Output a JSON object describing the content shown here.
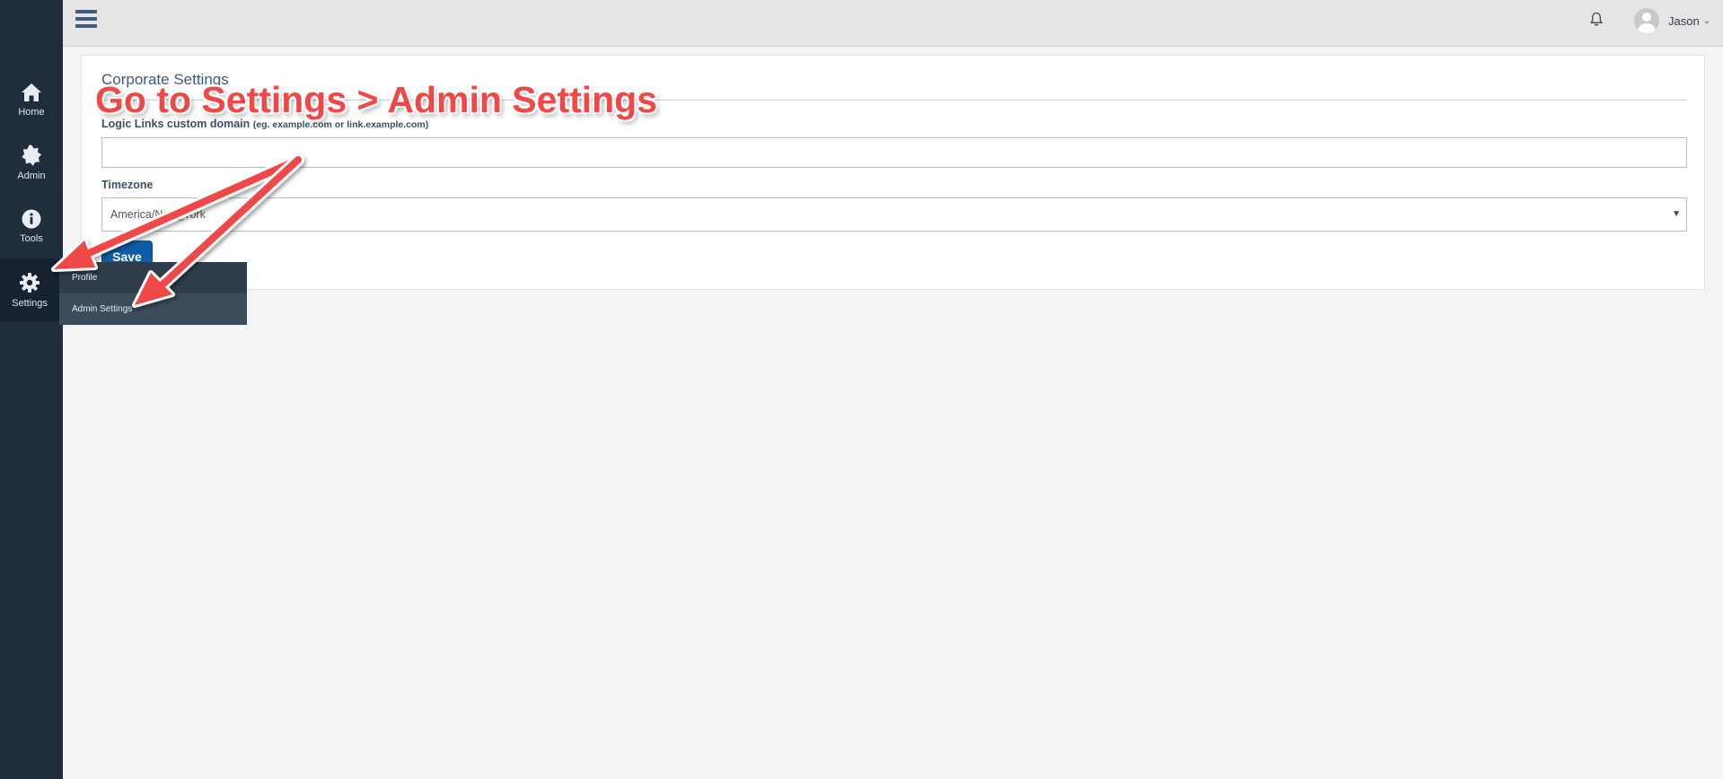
{
  "sidebar": {
    "items": [
      {
        "label": "Home",
        "icon": "home-icon"
      },
      {
        "label": "Admin",
        "icon": "badge-icon"
      },
      {
        "label": "Tools",
        "icon": "info-icon"
      },
      {
        "label": "Settings",
        "icon": "gear-icon"
      }
    ]
  },
  "flyout": {
    "items": [
      {
        "label": "Profile"
      },
      {
        "label": "Admin Settings"
      }
    ]
  },
  "topbar": {
    "user_name": "Jason",
    "user_caret": "⌄"
  },
  "panel": {
    "title": "Corporate Settings",
    "domain_label": "Logic Links custom domain",
    "domain_hint": "(eg. example.com or link.example.com)",
    "domain_value": "",
    "timezone_label": "Timezone",
    "timezone_value": "America/New_York",
    "timezone_caret": "▼",
    "save_label": "Save"
  },
  "annotation": {
    "text": "Go to Settings > Admin Settings"
  },
  "colors": {
    "sidebar_bg": "#1f2d3d",
    "accent": "#0f5da6",
    "annotation": "#f04747"
  }
}
